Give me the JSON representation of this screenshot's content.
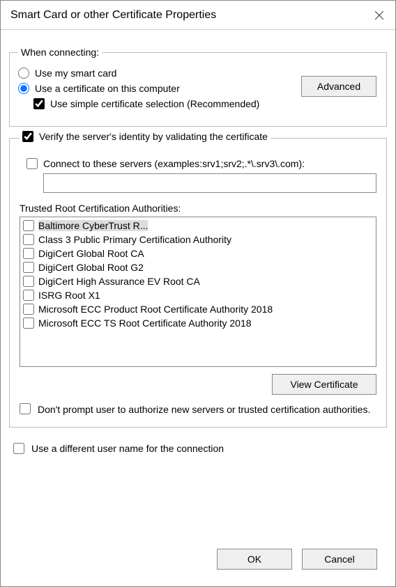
{
  "window": {
    "title": "Smart Card or other Certificate Properties"
  },
  "whenConnecting": {
    "legend": "When connecting:",
    "useSmartCard": "Use my smart card",
    "useCertOnComputer": "Use a certificate on this computer",
    "useSimpleSelection": "Use simple certificate selection (Recommended)",
    "advanced": "Advanced"
  },
  "verifyGroup": {
    "verifyServer": "Verify the server's identity by validating the certificate",
    "connectToServers": "Connect to these servers (examples:srv1;srv2;.*\\.srv3\\.com):",
    "serversValue": "",
    "trustedRootLabel": "Trusted Root Certification Authorities:",
    "authorities": [
      "Baltimore CyberTrust R...",
      "Class 3 Public Primary Certification Authority",
      "DigiCert Global Root CA",
      "DigiCert Global Root G2",
      "DigiCert High Assurance EV Root CA",
      "ISRG Root X1",
      "Microsoft ECC Product Root Certificate Authority 2018",
      "Microsoft ECC TS Root Certificate Authority 2018"
    ],
    "viewCertificate": "View Certificate",
    "noPrompt": "Don't prompt user to authorize new servers or trusted certification authorities."
  },
  "diffUser": "Use a different user name for the connection",
  "buttons": {
    "ok": "OK",
    "cancel": "Cancel"
  }
}
